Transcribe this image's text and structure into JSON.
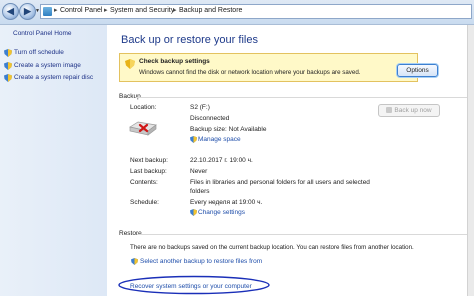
{
  "address": {
    "crumbs": [
      "Control Panel",
      "System and Security",
      "Backup and Restore"
    ]
  },
  "left": {
    "heading": "Control Panel Home",
    "links": [
      "Turn off schedule",
      "Create a system image",
      "Create a system repair disc"
    ]
  },
  "main": {
    "title": "Back up or restore your files",
    "warning": {
      "heading": "Check backup settings",
      "text": "Windows cannot find the disk or network location where your backups are saved.",
      "button": "Options"
    },
    "backup": {
      "section": "Backup",
      "back_up_now": "Back up now",
      "location_label": "Location:",
      "location_value": "S2 (F:)",
      "status": "Disconnected",
      "size": "Backup size: Not Available",
      "manage_space": "Manage space",
      "next_label": "Next backup:",
      "next_value": "22.10.2017 г. 19:00 ч.",
      "last_label": "Last backup:",
      "last_value": "Never",
      "contents_label": "Contents:",
      "contents_line1": "Files in libraries and personal folders for all users and selected",
      "contents_line2": "folders",
      "schedule_label": "Schedule:",
      "schedule_value": "Every неделя at 19:00 ч.",
      "change_settings": "Change settings"
    },
    "restore": {
      "section": "Restore",
      "text": "There are no backups saved on the current backup location. You can restore files from another location.",
      "select_link": "Select another backup to restore files from",
      "recover_link": "Recover system settings or your computer"
    }
  },
  "colors": {
    "link": "#1f4eaa",
    "title": "#1e3a8a",
    "warn_bg": "#fff9c8",
    "left_bg": "#e9f0f9"
  }
}
